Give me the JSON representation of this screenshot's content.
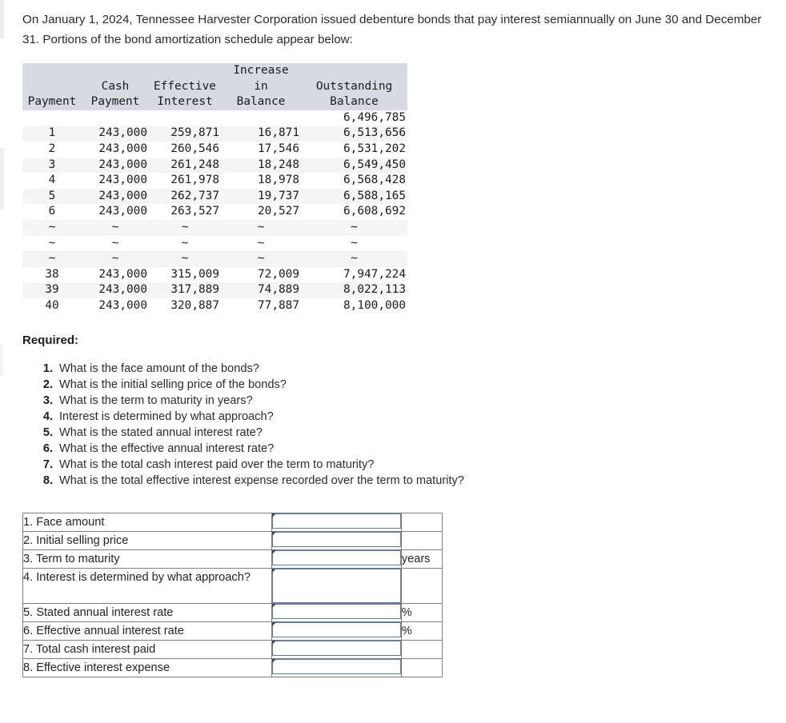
{
  "intro": {
    "text": "On January 1, 2024, Tennessee Harvester Corporation issued debenture bonds that pay interest semiannually on June 30 and December 31. Portions of the bond amortization schedule appear below:"
  },
  "amortization_table": {
    "header_line1": [
      "",
      "",
      "",
      "Increase",
      ""
    ],
    "header_line2": [
      "",
      "Cash",
      "Effective",
      "in",
      "Outstanding"
    ],
    "header_line3": [
      "Payment",
      "Payment",
      "Interest",
      "Balance",
      "Balance"
    ],
    "rows": [
      {
        "payment": "",
        "cash": "",
        "effective": "",
        "increase": "",
        "outstanding": "6,496,785"
      },
      {
        "payment": "1",
        "cash": "243,000",
        "effective": "259,871",
        "increase": "16,871",
        "outstanding": "6,513,656"
      },
      {
        "payment": "2",
        "cash": "243,000",
        "effective": "260,546",
        "increase": "17,546",
        "outstanding": "6,531,202"
      },
      {
        "payment": "3",
        "cash": "243,000",
        "effective": "261,248",
        "increase": "18,248",
        "outstanding": "6,549,450"
      },
      {
        "payment": "4",
        "cash": "243,000",
        "effective": "261,978",
        "increase": "18,978",
        "outstanding": "6,568,428"
      },
      {
        "payment": "5",
        "cash": "243,000",
        "effective": "262,737",
        "increase": "19,737",
        "outstanding": "6,588,165"
      },
      {
        "payment": "6",
        "cash": "243,000",
        "effective": "263,527",
        "increase": "20,527",
        "outstanding": "6,608,692"
      },
      {
        "payment": "~",
        "cash": "~",
        "effective": "~",
        "increase": "~",
        "outstanding": "~"
      },
      {
        "payment": "~",
        "cash": "~",
        "effective": "~",
        "increase": "~",
        "outstanding": "~"
      },
      {
        "payment": "~",
        "cash": "~",
        "effective": "~",
        "increase": "~",
        "outstanding": "~"
      },
      {
        "payment": "38",
        "cash": "243,000",
        "effective": "315,009",
        "increase": "72,009",
        "outstanding": "7,947,224"
      },
      {
        "payment": "39",
        "cash": "243,000",
        "effective": "317,889",
        "increase": "74,889",
        "outstanding": "8,022,113"
      },
      {
        "payment": "40",
        "cash": "243,000",
        "effective": "320,887",
        "increase": "77,887",
        "outstanding": "8,100,000"
      }
    ],
    "header_background": "#d6dae3",
    "stripe_background": "#f5f5f5"
  },
  "required": {
    "heading": "Required:",
    "questions": [
      {
        "num": "1.",
        "text": "What is the face amount of the bonds?"
      },
      {
        "num": "2.",
        "text": "What is the initial selling price of the bonds?"
      },
      {
        "num": "3.",
        "text": "What is the term to maturity in years?"
      },
      {
        "num": "4.",
        "text": "Interest is determined by what approach?"
      },
      {
        "num": "5.",
        "text": "What is the stated annual interest rate?"
      },
      {
        "num": "6.",
        "text": "What is the effective annual interest rate?"
      },
      {
        "num": "7.",
        "text": "What is the total cash interest paid over the term to maturity?"
      },
      {
        "num": "8.",
        "text": "What is the total effective interest expense recorded over the term to maturity?"
      }
    ]
  },
  "answer_form": {
    "input_border_color": "#5a7cab",
    "rows": [
      {
        "label": "1. Face amount",
        "value": "",
        "unit": ""
      },
      {
        "label": "2. Initial selling price",
        "value": "",
        "unit": ""
      },
      {
        "label": "3. Term to maturity",
        "value": "",
        "unit": "years"
      },
      {
        "label": "4. Interest is determined by what approach?",
        "value": "",
        "unit": ""
      },
      {
        "label": "5. Stated annual interest rate",
        "value": "",
        "unit": "%"
      },
      {
        "label": "6. Effective annual interest rate",
        "value": "",
        "unit": "%"
      },
      {
        "label": "7. Total cash interest paid",
        "value": "",
        "unit": ""
      },
      {
        "label": "8. Effective interest expense",
        "value": "",
        "unit": ""
      }
    ]
  }
}
